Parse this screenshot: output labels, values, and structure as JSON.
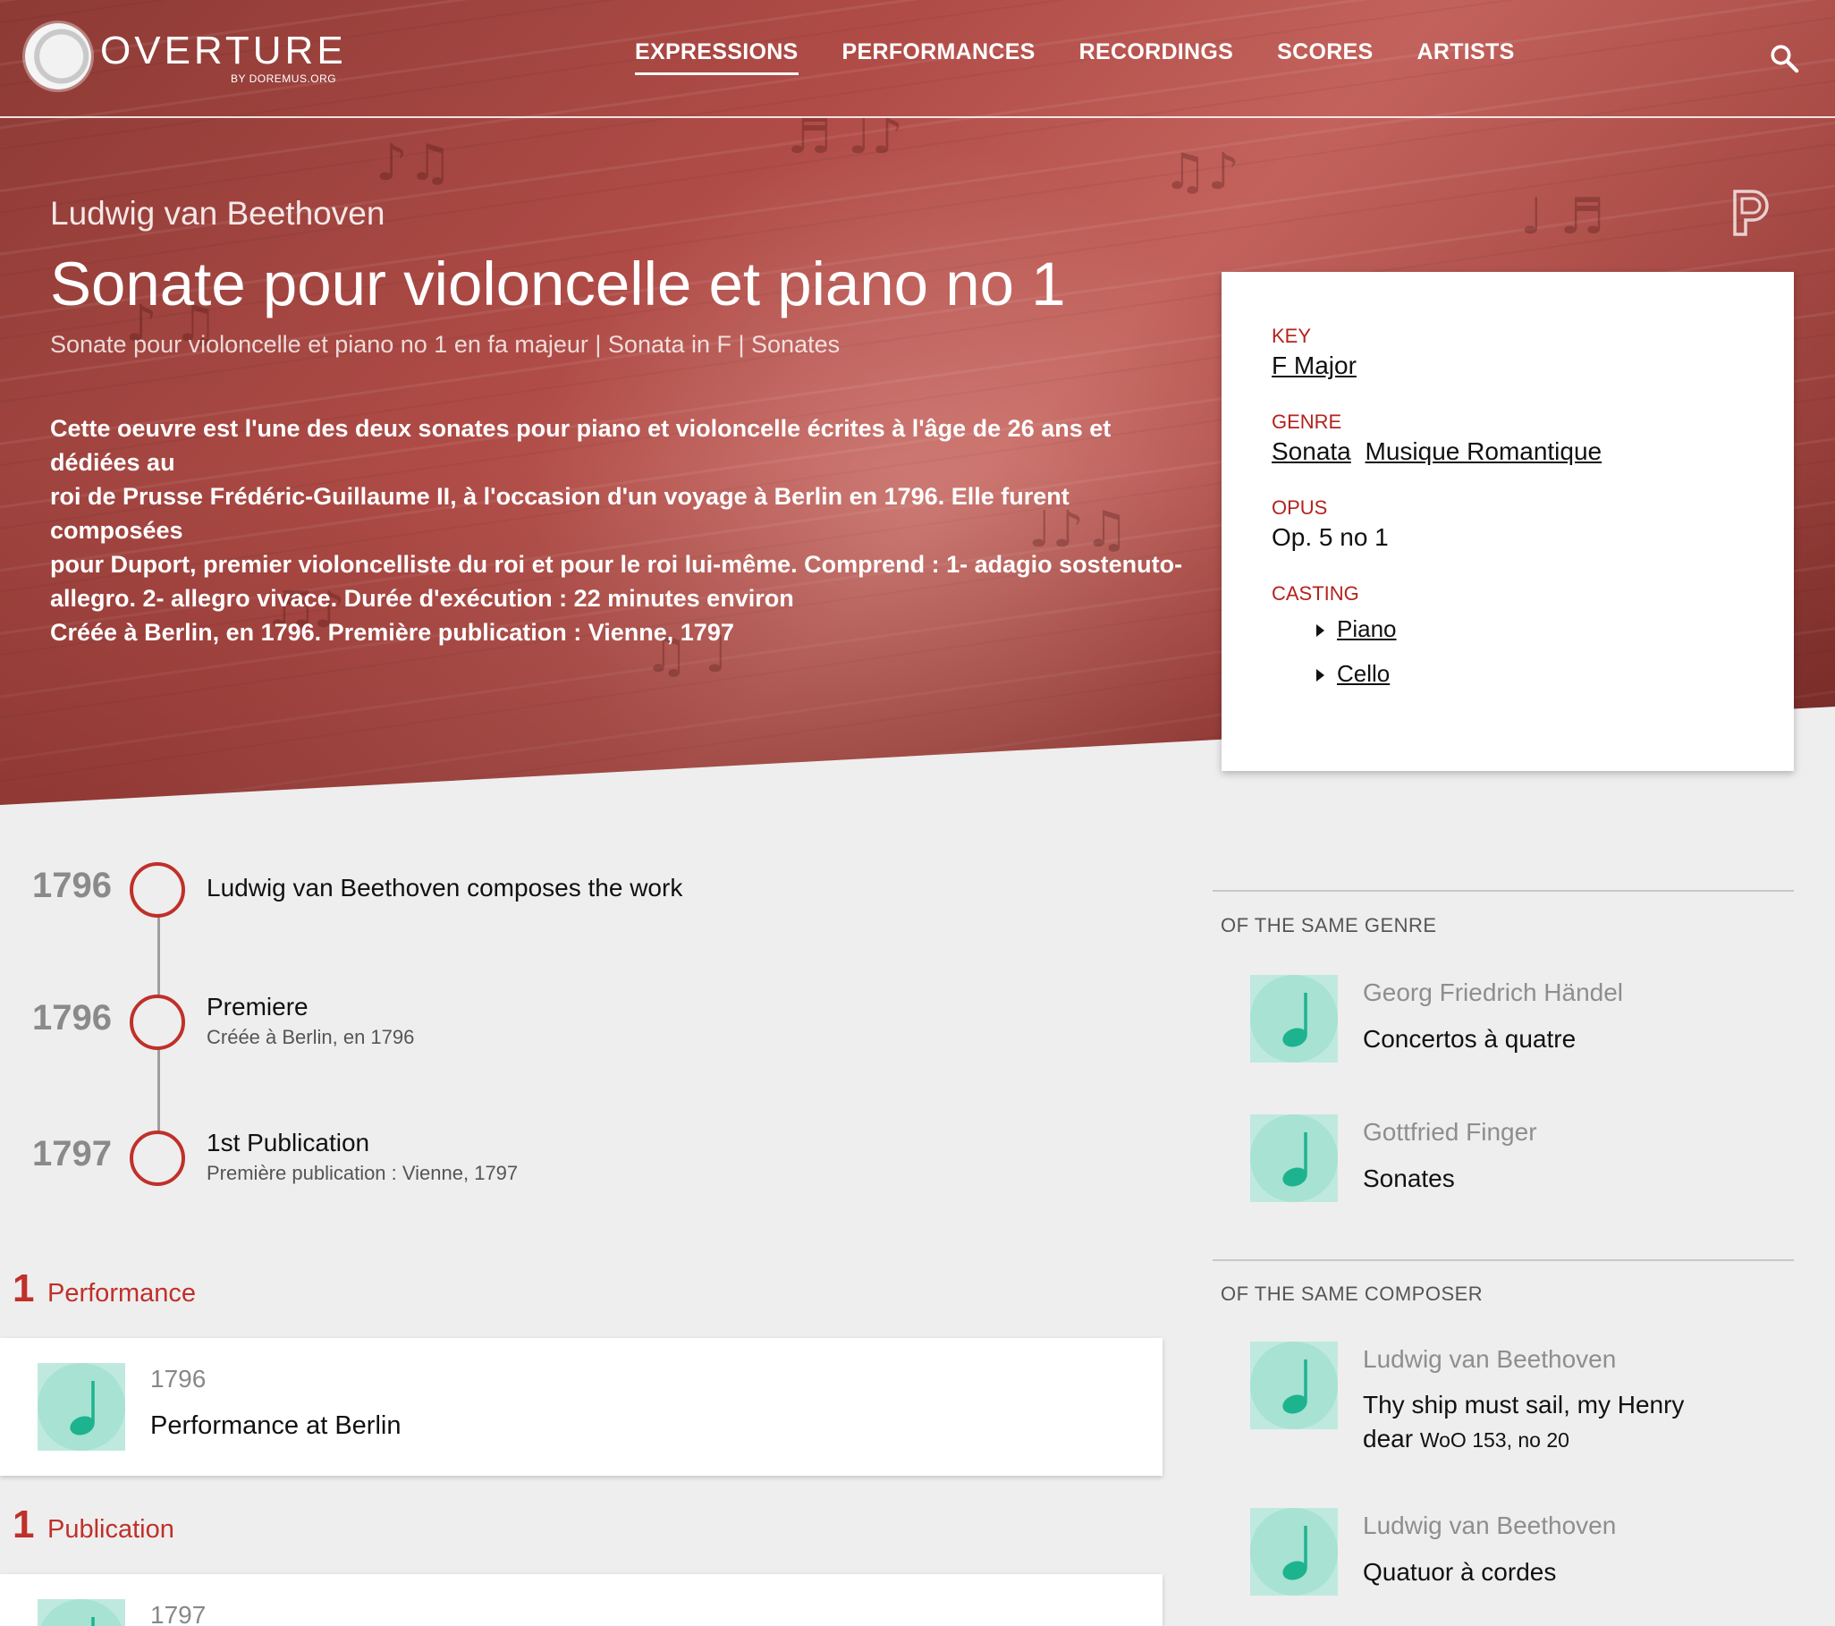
{
  "nav": {
    "logo_word": "OVERTURE",
    "logo_sub": "BY DOREMUS.ORG",
    "links": [
      "EXPRESSIONS",
      "PERFORMANCES",
      "RECORDINGS",
      "SCORES",
      "ARTISTS"
    ],
    "active": "EXPRESSIONS"
  },
  "hero": {
    "composer": "Ludwig van Beethoven",
    "title": "Sonate pour violoncelle et piano no 1",
    "subtitle": "Sonate pour violoncelle et piano no 1 en fa majeur | Sonata in F | Sonates",
    "description_lines": [
      "Cette oeuvre est l'une des deux sonates pour piano et violoncelle écrites à l'âge de 26 ans et dédiées au",
      "roi de Prusse Frédéric-Guillaume II, à l'occasion d'un voyage à Berlin en 1796. Elle furent composées",
      "pour Duport, premier violoncelliste du roi et pour le roi lui-même. Comprend : 1- adagio sostenuto-",
      "allegro. 2- allegro vivace. Durée d'exécution : 22 minutes environ",
      "Créée à Berlin, en 1796. Première publication : Vienne, 1797"
    ]
  },
  "info": {
    "key_label": "KEY",
    "key_value": "F Major",
    "genre_label": "GENRE",
    "genres": [
      "Sonata",
      "Musique Romantique"
    ],
    "opus_label": "OPUS",
    "opus_value": "Op. 5 no 1",
    "casting_label": "CASTING",
    "casting": [
      "Piano",
      "Cello"
    ]
  },
  "timeline": [
    {
      "year": "1796",
      "title": "Ludwig van Beethoven composes the work",
      "sub": ""
    },
    {
      "year": "1796",
      "title": "Premiere",
      "sub": "Créée à Berlin, en 1796"
    },
    {
      "year": "1797",
      "title": "1st Publication",
      "sub": "Première publication : Vienne, 1797"
    }
  ],
  "performances": {
    "count": "1",
    "label": "Performance",
    "items": [
      {
        "year": "1796",
        "title": "Performance at Berlin"
      }
    ]
  },
  "publications": {
    "count": "1",
    "label": "Publication",
    "items": [
      {
        "year": "1797"
      }
    ]
  },
  "same_genre": {
    "heading": "OF THE SAME GENRE",
    "items": [
      {
        "composer": "Georg Friedrich Händel",
        "title": "Concertos à quatre"
      },
      {
        "composer": "Gottfried Finger",
        "title": "Sonates"
      }
    ]
  },
  "same_composer": {
    "heading": "OF THE SAME COMPOSER",
    "items": [
      {
        "composer": "Ludwig van Beethoven",
        "title_line1": "Thy ship must sail, my Henry",
        "title_line2": "dear",
        "title_suffix": "WoO 153, no 20"
      },
      {
        "composer": "Ludwig van Beethoven",
        "title": "Quatuor à cordes"
      }
    ]
  },
  "colors": {
    "accent": "#c0302a",
    "hero": "#a8443f",
    "thumb": "#bfe9de",
    "note": "#1db38e"
  },
  "icons": {
    "search": "search-icon",
    "logo": "logo-icon",
    "p": "p-icon",
    "note": "music-note-icon",
    "casting_bullet": "triangle-right-icon"
  }
}
